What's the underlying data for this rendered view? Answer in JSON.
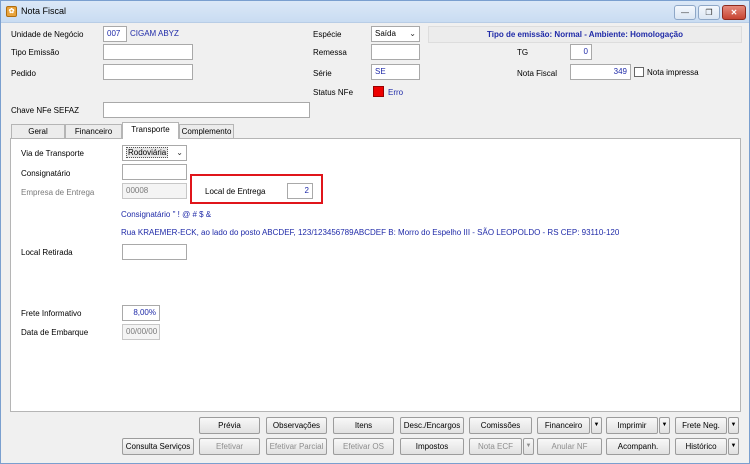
{
  "window": {
    "title": "Nota Fiscal",
    "controls": [
      "—",
      "❐",
      "✕"
    ]
  },
  "header": {
    "unidade_label": "Unidade de Negócio",
    "unidade_code": "007",
    "unidade_name": "CIGAM ABYZ",
    "tipo_emissao_label": "Tipo Emissão",
    "pedido_label": "Pedido",
    "especie_label": "Espécie",
    "especie_value": "Saída",
    "remessa_label": "Remessa",
    "serie_label": "Série",
    "serie_value": "SE",
    "status_label": "Status NFe",
    "status_value": "Erro",
    "status_color": "#e00000",
    "info_text": "Tipo de emissão: Normal - Ambiente: Homologação",
    "tg_label": "TG",
    "tg_value": "0",
    "nota_fiscal_label": "Nota Fiscal",
    "nota_fiscal_value": "349",
    "nota_impressa_label": "Nota impressa",
    "chave_label": "Chave NFe SEFAZ"
  },
  "tabs": [
    "Geral",
    "Financeiro",
    "Transporte",
    "Complemento"
  ],
  "active_tab": "Transporte",
  "transporte": {
    "via_label": "Via de Transporte",
    "via_value": "Rodoviária",
    "consignatario_label": "Consignatário",
    "empresa_label": "Empresa de Entrega",
    "empresa_value": "00008",
    "local_entrega_label": "Local de Entrega",
    "local_entrega_value": "2",
    "consignatario_text": "Consignatário \" ! @ # $ &",
    "address_text": "Rua KRAEMER-ECK, ao lado do posto ABCDEF, 123/123456789ABCDEF B: Morro do Espelho III - SÃO LEOPOLDO - RS CEP: 93110-120",
    "local_retirada_label": "Local Retirada",
    "frete_label": "Frete Informativo",
    "frete_value": "8,00%",
    "embarque_label": "Data de Embarque",
    "embarque_value": "00/00/00"
  },
  "buttons_row1": [
    "Prévia",
    "Observações",
    "Itens",
    "Desc./Encargos",
    "Comissões",
    "Financeiro",
    "Imprimir",
    "Frete Neg."
  ],
  "buttons_row2": [
    "Consulta Serviços",
    "Efetivar",
    "Efetivar Parcial",
    "Efetivar OS",
    "Impostos",
    "Nota ECF",
    "Anular NF",
    "Acompanh.",
    "Histórico"
  ],
  "accent_highlight": "#e0151b",
  "text_blue": "#1f2aa8"
}
